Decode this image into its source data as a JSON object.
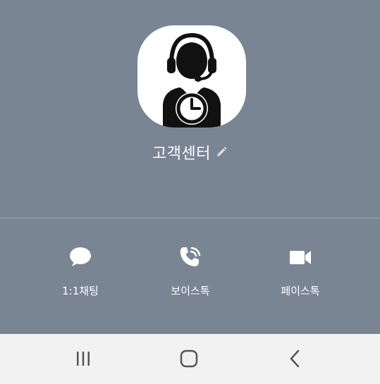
{
  "contact": {
    "name": "고객센터",
    "avatar_icon": "customer-service-agent-clock-icon"
  },
  "actions": [
    {
      "label": "1:1채팅",
      "icon": "chat-bubble-icon"
    },
    {
      "label": "보이스톡",
      "icon": "phone-call-icon"
    },
    {
      "label": "페이스톡",
      "icon": "video-camera-icon"
    }
  ],
  "navbar": {
    "recent_icon": "recent-apps-icon",
    "home_icon": "home-icon",
    "back_icon": "back-icon"
  },
  "colors": {
    "background": "#7a8594",
    "navbar": "#f2f2f2",
    "text": "#ffffff"
  }
}
